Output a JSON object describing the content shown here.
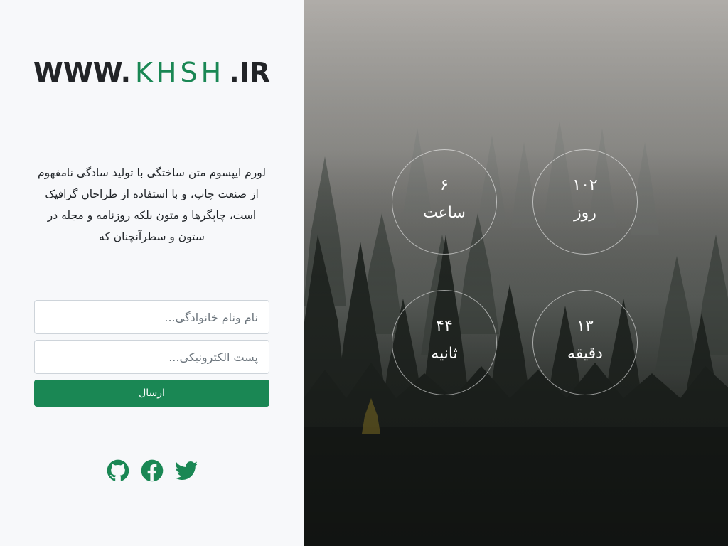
{
  "logo": {
    "prefix": "WWW.",
    "brand": "KHSH",
    "suffix": ".IR"
  },
  "description": "لورم ایپسوم متن ساختگی با تولید سادگی نامفهوم از صنعت چاپ، و با استفاده از طراحان گرافیک است، چاپگرها و متون بلکه روزنامه و مجله در ستون و سطرآنچنان که",
  "form": {
    "name_placeholder": "نام ونام خانوادگی...",
    "email_placeholder": "پست الکترونیکی...",
    "submit_label": "ارسال"
  },
  "social": {
    "icons": [
      "github-icon",
      "facebook-icon",
      "twitter-icon"
    ]
  },
  "countdown": {
    "days": {
      "value": "۱۰۲",
      "unit": "روز"
    },
    "hours": {
      "value": "۶",
      "unit": "ساعت"
    },
    "minutes": {
      "value": "۱۳",
      "unit": "دقیقه"
    },
    "seconds": {
      "value": "۴۴",
      "unit": "ثانیه"
    }
  },
  "colors": {
    "brand": "#1a8754",
    "panel_background": "#f7f8fa",
    "text": "#212529"
  }
}
